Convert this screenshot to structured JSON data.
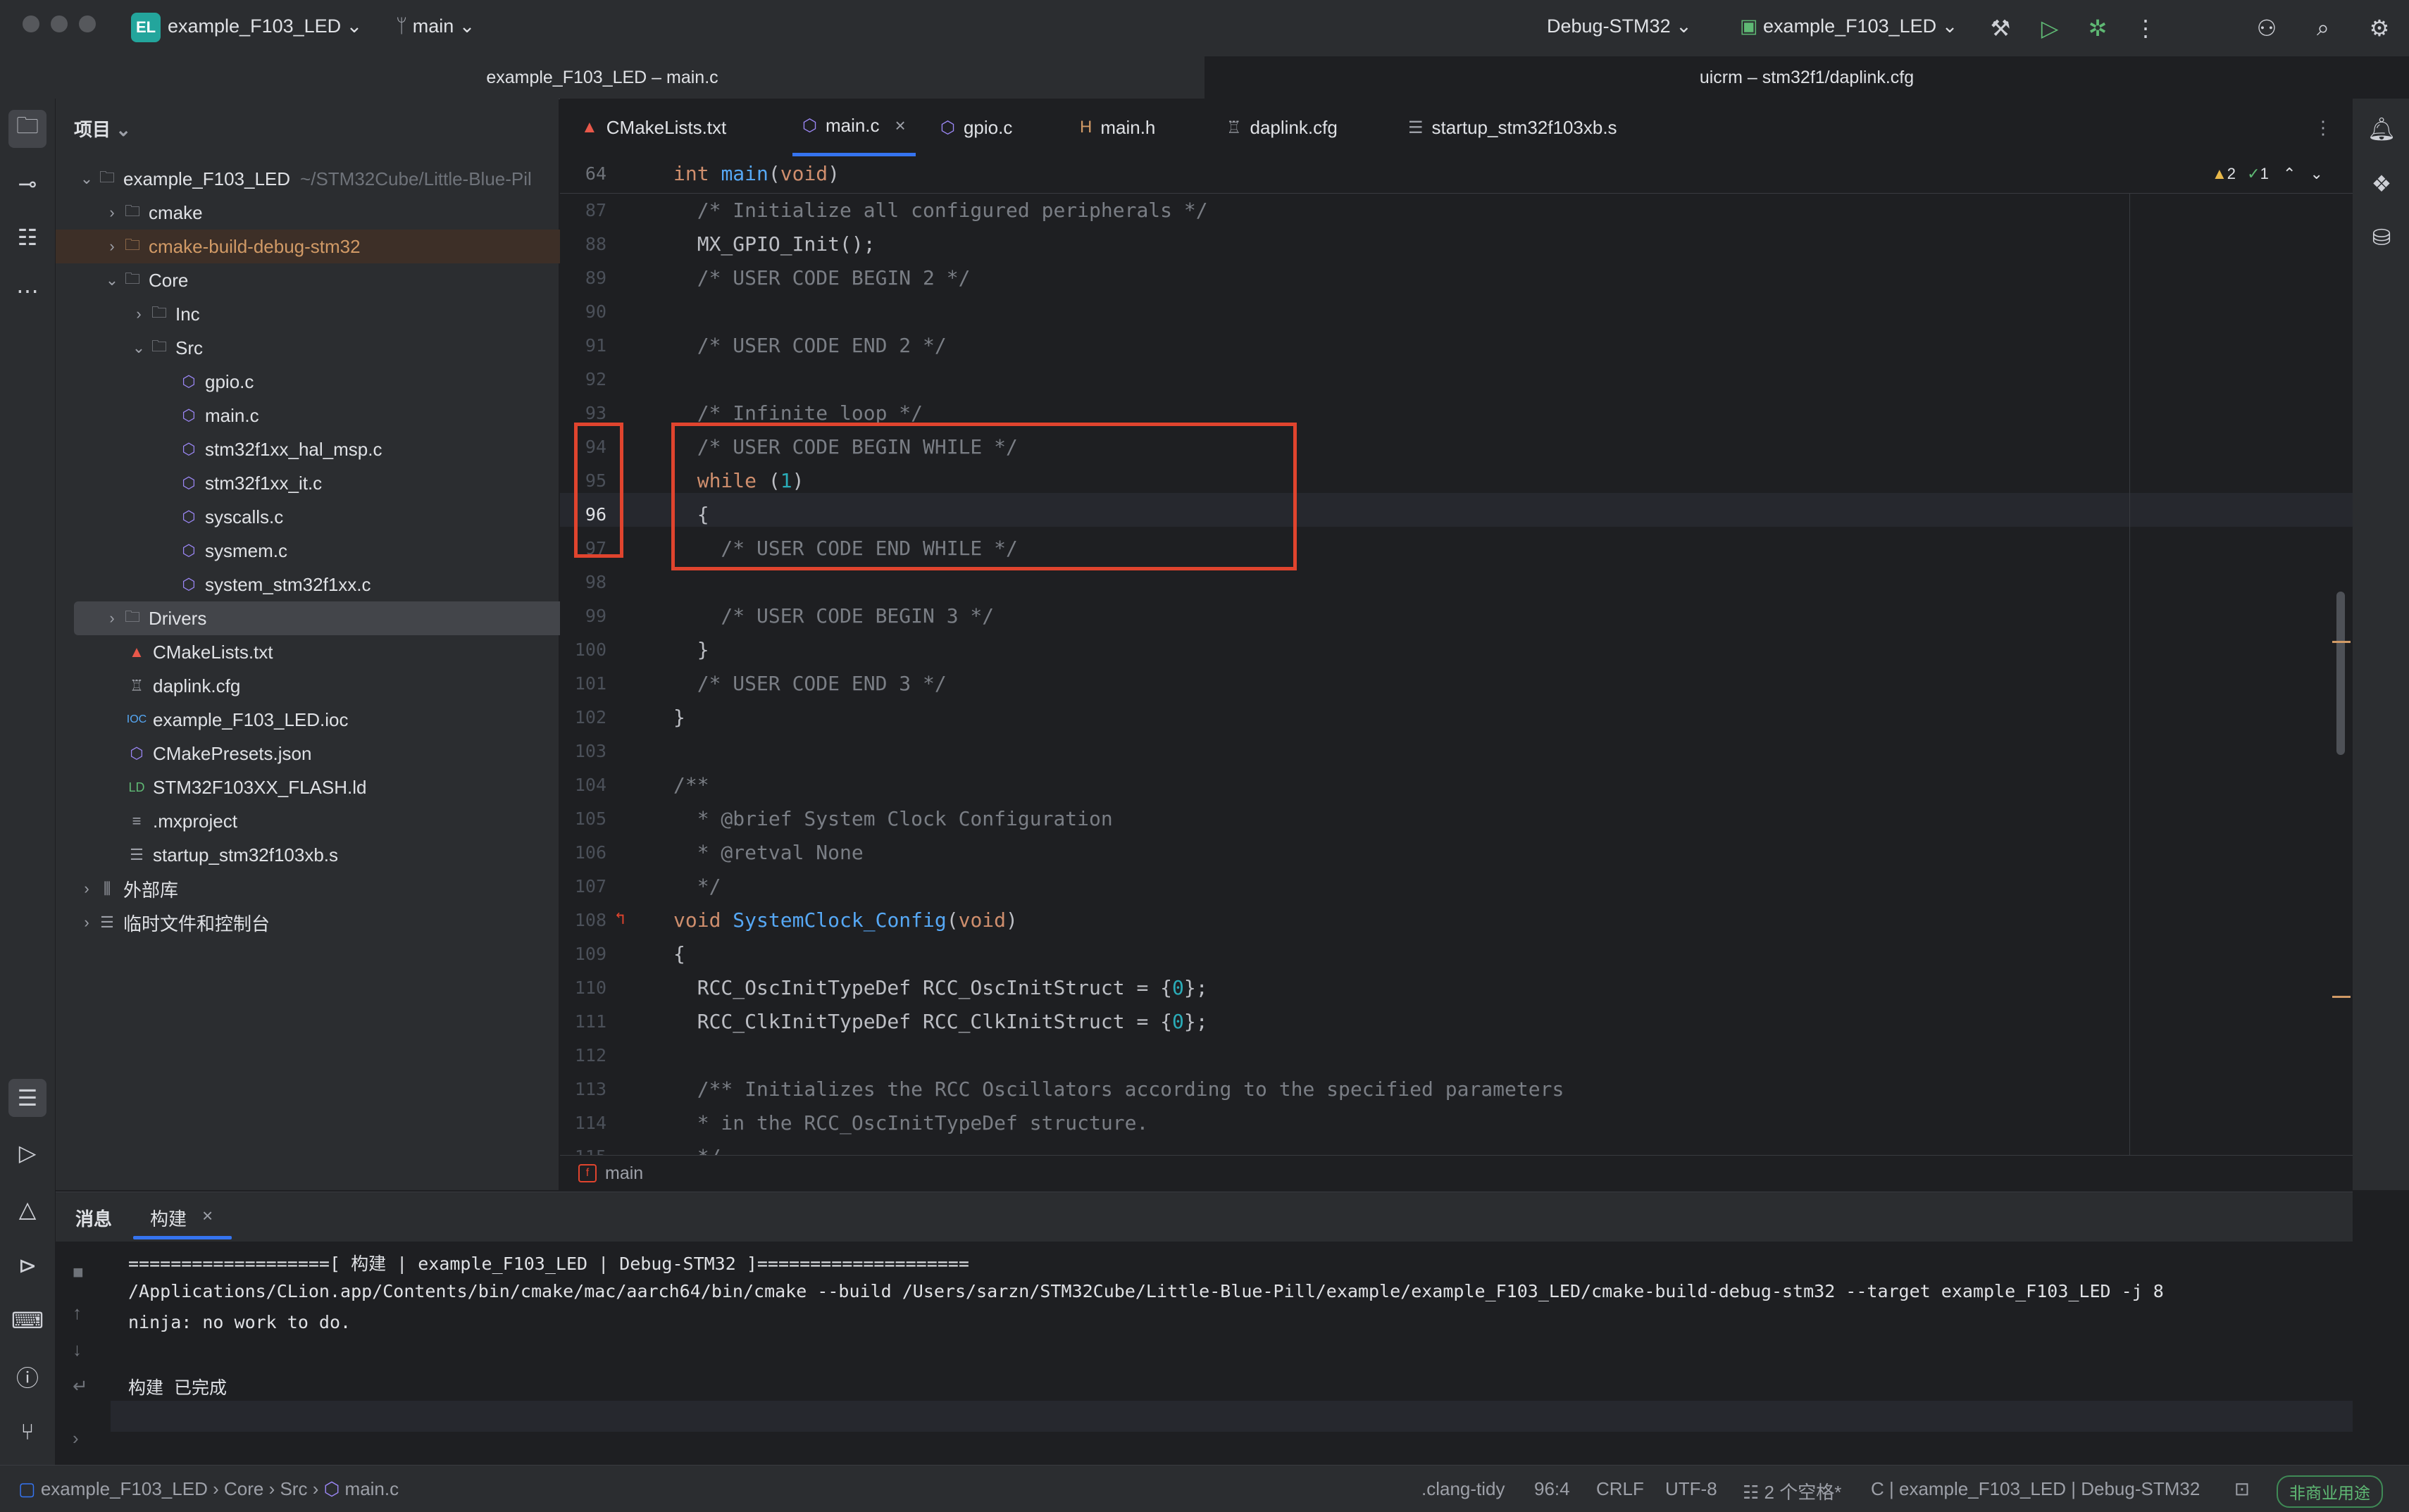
{
  "titlebar": {
    "project_badge": "EL",
    "project_name": "example_F103_LED",
    "branch": "main",
    "run_config": "Debug-STM32",
    "target": "example_F103_LED"
  },
  "window_tabs": [
    "example_F103_LED – main.c",
    "uicrm – stm32f1/daplink.cfg"
  ],
  "project_panel": {
    "header": "项目",
    "root": "example_F103_LED",
    "root_path": "~/STM32Cube/Little-Blue-Pil",
    "items": [
      {
        "label": "cmake",
        "type": "folder"
      },
      {
        "label": "cmake-build-debug-stm32",
        "type": "folder-excluded"
      },
      {
        "label": "Core",
        "type": "folder"
      },
      {
        "label": "Inc",
        "type": "folder"
      },
      {
        "label": "Src",
        "type": "folder"
      },
      {
        "label": "gpio.c",
        "type": "c-file"
      },
      {
        "label": "main.c",
        "type": "c-file"
      },
      {
        "label": "stm32f1xx_hal_msp.c",
        "type": "c-file"
      },
      {
        "label": "stm32f1xx_it.c",
        "type": "c-file"
      },
      {
        "label": "syscalls.c",
        "type": "c-file"
      },
      {
        "label": "sysmem.c",
        "type": "c-file"
      },
      {
        "label": "system_stm32f1xx.c",
        "type": "c-file"
      },
      {
        "label": "Drivers",
        "type": "folder"
      },
      {
        "label": "CMakeLists.txt",
        "type": "cmake-file"
      },
      {
        "label": "daplink.cfg",
        "type": "cfg-file"
      },
      {
        "label": "example_F103_LED.ioc",
        "type": "ioc-file"
      },
      {
        "label": "CMakePresets.json",
        "type": "json-file"
      },
      {
        "label": "STM32F103XX_FLASH.ld",
        "type": "ld-file"
      },
      {
        "label": ".mxproject",
        "type": "text-file"
      },
      {
        "label": "startup_stm32f103xb.s",
        "type": "asm-file"
      },
      {
        "label": "外部库",
        "type": "library"
      },
      {
        "label": "临时文件和控制台",
        "type": "scratch"
      }
    ]
  },
  "editor_tabs": [
    {
      "label": "CMakeLists.txt"
    },
    {
      "label": "main.c"
    },
    {
      "label": "gpio.c"
    },
    {
      "label": "main.h"
    },
    {
      "label": "daplink.cfg"
    },
    {
      "label": "startup_stm32f103xb.s"
    }
  ],
  "editor": {
    "sticky_line_number": "64",
    "sticky_line": "int main(void)",
    "inspections": {
      "warnings": "2",
      "ok": "1"
    },
    "lines": [
      {
        "n": "87",
        "text": "  /* Initialize all configured peripherals */"
      },
      {
        "n": "88",
        "text": "  MX_GPIO_Init();"
      },
      {
        "n": "89",
        "text": "  /* USER CODE BEGIN 2 */"
      },
      {
        "n": "90",
        "text": ""
      },
      {
        "n": "91",
        "text": "  /* USER CODE END 2 */"
      },
      {
        "n": "92",
        "text": ""
      },
      {
        "n": "93",
        "text": "  /* Infinite loop */"
      },
      {
        "n": "94",
        "text": "  /* USER CODE BEGIN WHILE */"
      },
      {
        "n": "95",
        "text": "  while (1)"
      },
      {
        "n": "96",
        "text": "  {"
      },
      {
        "n": "97",
        "text": "    /* USER CODE END WHILE */"
      },
      {
        "n": "98",
        "text": ""
      },
      {
        "n": "99",
        "text": "    /* USER CODE BEGIN 3 */"
      },
      {
        "n": "100",
        "text": "  }"
      },
      {
        "n": "101",
        "text": "  /* USER CODE END 3 */"
      },
      {
        "n": "102",
        "text": "}"
      },
      {
        "n": "103",
        "text": ""
      },
      {
        "n": "104",
        "text": "/**"
      },
      {
        "n": "105",
        "text": "  * @brief System Clock Configuration"
      },
      {
        "n": "106",
        "text": "  * @retval None"
      },
      {
        "n": "107",
        "text": "  */"
      },
      {
        "n": "108",
        "text": "void SystemClock_Config(void)"
      },
      {
        "n": "109",
        "text": "{"
      },
      {
        "n": "110",
        "text": "  RCC_OscInitTypeDef RCC_OscInitStruct = {0};"
      },
      {
        "n": "111",
        "text": "  RCC_ClkInitTypeDef RCC_ClkInitStruct = {0};"
      },
      {
        "n": "112",
        "text": ""
      },
      {
        "n": "113",
        "text": "  /** Initializes the RCC Oscillators according to the specified parameters"
      },
      {
        "n": "114",
        "text": "  * in the RCC_OscInitTypeDef structure."
      },
      {
        "n": "115",
        "text": "  */"
      }
    ],
    "breadcrumb": "main"
  },
  "build_panel": {
    "tabs": [
      "消息",
      "构建"
    ],
    "output": [
      "===================[ 构建 | example_F103_LED | Debug-STM32 ]====================",
      "/Applications/CLion.app/Contents/bin/cmake/mac/aarch64/bin/cmake --build /Users/sarzn/STM32Cube/Little-Blue-Pill/example/example_F103_LED/cmake-build-debug-stm32 --target example_F103_LED -j 8",
      "ninja: no work to do.",
      "",
      "构建 已完成"
    ]
  },
  "statusbar": {
    "breadcrumb": [
      "example_F103_LED",
      "Core",
      "Src",
      "main.c"
    ],
    "linter": ".clang-tidy",
    "position": "96:4",
    "line_ending": "CRLF",
    "encoding": "UTF-8",
    "indent": "2 个空格*",
    "context": "C | example_F103_LED | Debug-STM32",
    "license": "非商业用途"
  },
  "colors": {
    "accent": "#3574f0",
    "highlight_box": "#e0442e",
    "excluded_folder": "#d19a66"
  }
}
